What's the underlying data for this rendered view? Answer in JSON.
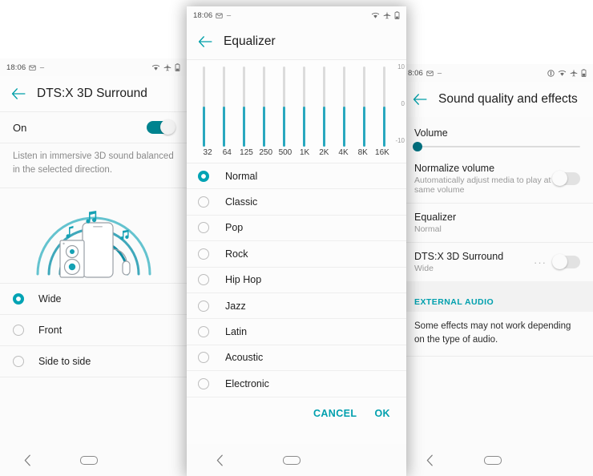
{
  "accent": {
    "teal": "#00a0ae",
    "eq_bar": "#29a8bf",
    "toggle_on": "#00838f",
    "slider_thumb": "#00707f"
  },
  "left_screen": {
    "statusbar": {
      "time": "18:06",
      "icons": [
        "mail-icon",
        "dash-icon",
        "wifi-icon",
        "airplane-icon",
        "battery-icon"
      ]
    },
    "appbar": {
      "back": "back-arrow-icon",
      "title": "DTS:X 3D Surround"
    },
    "master": {
      "label": "On",
      "toggle_state": "on"
    },
    "description": "Listen in immersive 3D sound balanced in the selected direction.",
    "illustration": "dtsx-3d-surround-illustration",
    "options": [
      {
        "label": "Wide",
        "selected": true
      },
      {
        "label": "Front",
        "selected": false
      },
      {
        "label": "Side to side",
        "selected": false
      }
    ],
    "navbar": [
      "back-nav-icon",
      "home-nav-icon"
    ]
  },
  "center_screen": {
    "statusbar": {
      "time": "18:06",
      "icons": [
        "mail-icon",
        "dash-icon",
        "wifi-icon",
        "airplane-icon",
        "battery-icon"
      ]
    },
    "appbar": {
      "back": "back-arrow-icon",
      "title": "Equalizer"
    },
    "equalizer": {
      "scale_labels": [
        "10",
        "0",
        "-10"
      ],
      "range": [
        -10,
        10
      ],
      "bands": [
        {
          "freq": "32",
          "gain": 0
        },
        {
          "freq": "64",
          "gain": 0
        },
        {
          "freq": "125",
          "gain": 0
        },
        {
          "freq": "250",
          "gain": 0
        },
        {
          "freq": "500",
          "gain": 0
        },
        {
          "freq": "1K",
          "gain": 0
        },
        {
          "freq": "2K",
          "gain": 0
        },
        {
          "freq": "4K",
          "gain": 0
        },
        {
          "freq": "8K",
          "gain": 0
        },
        {
          "freq": "16K",
          "gain": 0
        }
      ]
    },
    "presets": [
      {
        "label": "Normal",
        "selected": true
      },
      {
        "label": "Classic",
        "selected": false
      },
      {
        "label": "Pop",
        "selected": false
      },
      {
        "label": "Rock",
        "selected": false
      },
      {
        "label": "Hip Hop",
        "selected": false
      },
      {
        "label": "Jazz",
        "selected": false
      },
      {
        "label": "Latin",
        "selected": false
      },
      {
        "label": "Acoustic",
        "selected": false
      },
      {
        "label": "Electronic",
        "selected": false
      }
    ],
    "actions": {
      "cancel": "CANCEL",
      "ok": "OK"
    },
    "navbar": [
      "back-nav-icon",
      "home-nav-icon"
    ]
  },
  "right_screen": {
    "statusbar": {
      "time": "8:06",
      "icons": [
        "mail-icon",
        "dash-icon",
        "dnd-icon",
        "wifi-icon",
        "airplane-icon",
        "battery-icon"
      ]
    },
    "appbar": {
      "back": "back-arrow-icon",
      "title": "Sound quality and effects"
    },
    "volume": {
      "label": "Volume",
      "value_percent": 3
    },
    "items": [
      {
        "title": "Normalize volume",
        "subtitle": "Automatically adjust media to play at same volume",
        "toggle_state": "off",
        "has_toggle": true
      },
      {
        "title": "Equalizer",
        "subtitle": "Normal",
        "has_toggle": false
      },
      {
        "title": "DTS:X 3D Surround",
        "subtitle": "Wide",
        "toggle_state": "off",
        "has_toggle": true,
        "has_more": true
      }
    ],
    "section_header": "EXTERNAL AUDIO",
    "section_note": "Some effects may not work depending on the type of audio.",
    "navbar": [
      "back-nav-icon",
      "home-nav-icon"
    ]
  }
}
